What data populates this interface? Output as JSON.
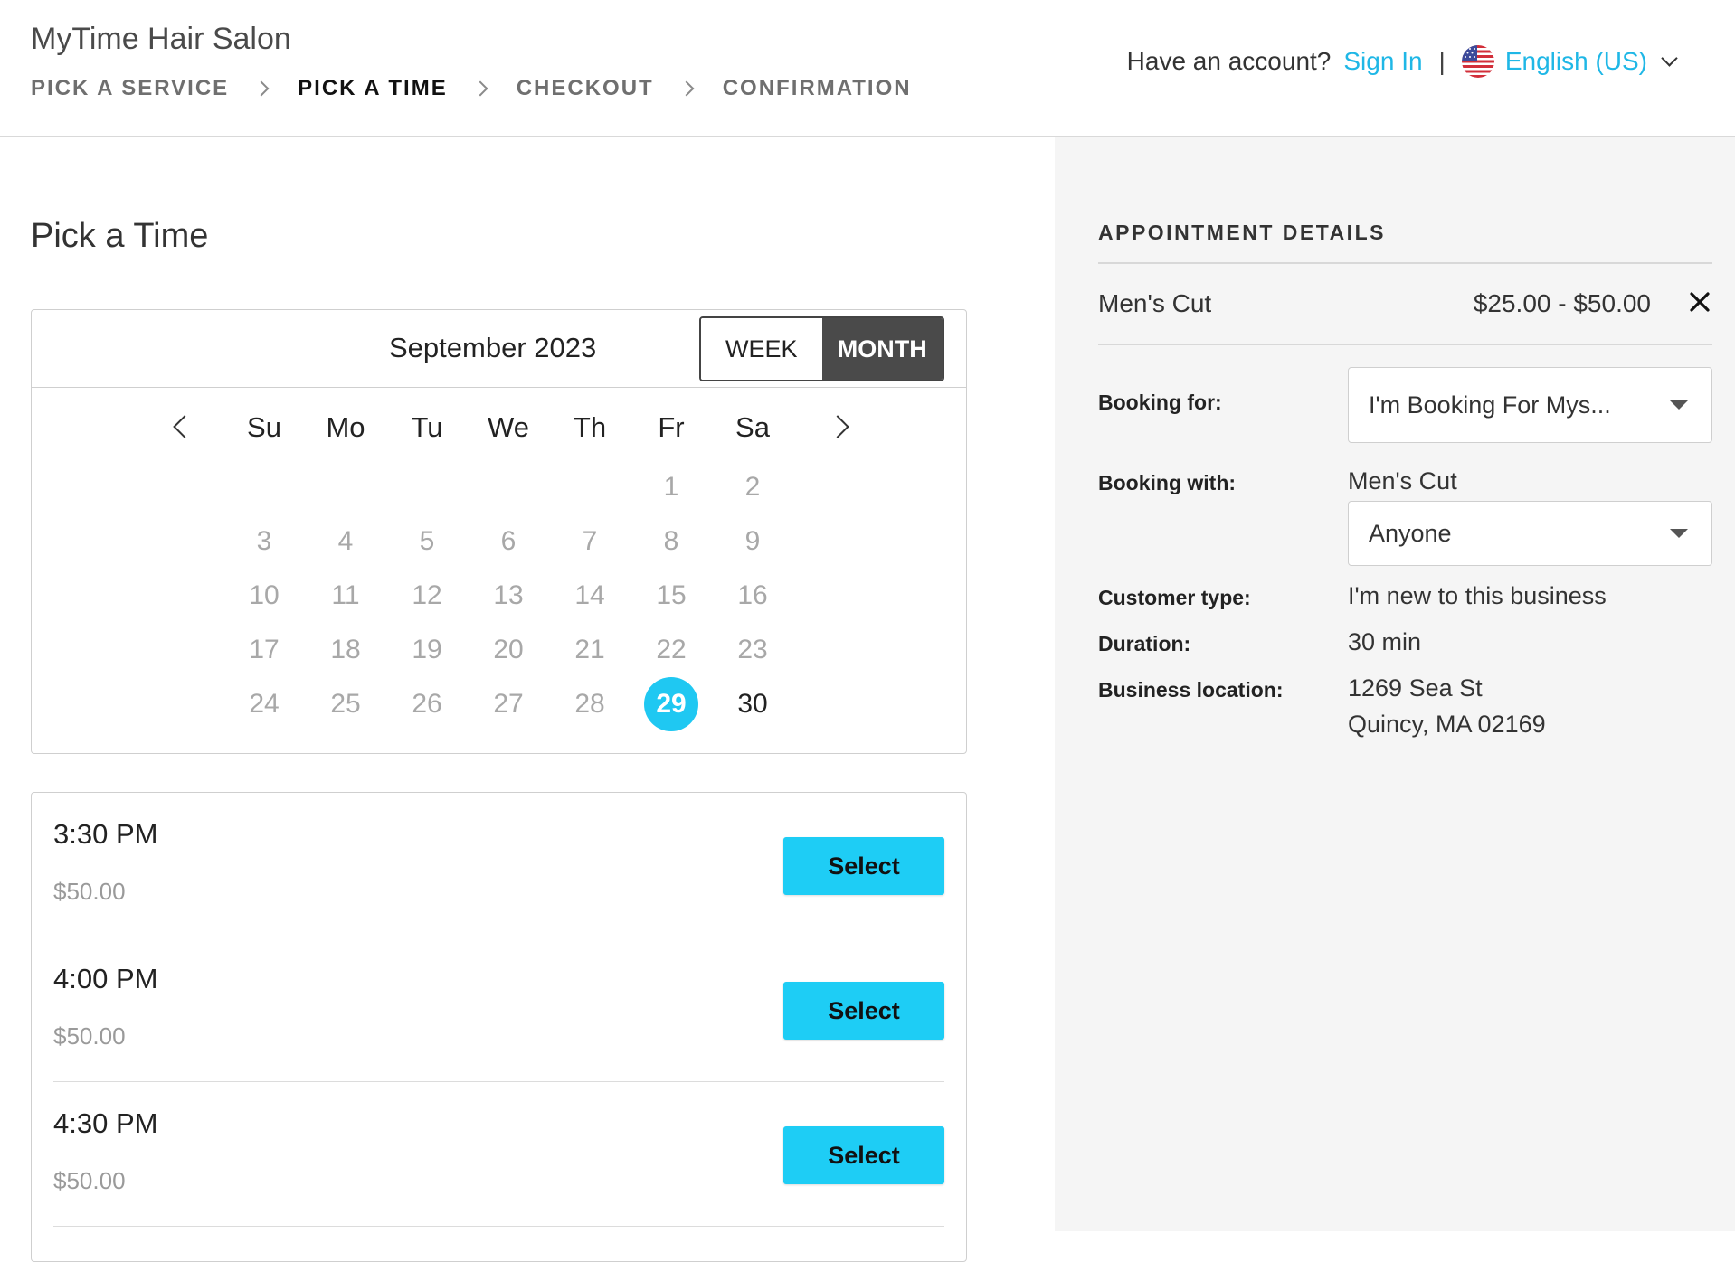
{
  "header": {
    "salon_name": "MyTime Hair Salon",
    "steps": [
      {
        "label": "PICK A SERVICE",
        "active": false
      },
      {
        "label": "PICK A TIME",
        "active": true
      },
      {
        "label": "CHECKOUT",
        "active": false
      },
      {
        "label": "CONFIRMATION",
        "active": false
      }
    ],
    "account_prompt": "Have an account?",
    "sign_in": "Sign In",
    "divider": "|",
    "language": "English (US)",
    "flag_icon": "us-flag-icon"
  },
  "main": {
    "title": "Pick a Time",
    "calendar": {
      "month_label": "September 2023",
      "view_week": "WEEK",
      "view_month": "MONTH",
      "active_view": "MONTH",
      "weekdays": [
        "Su",
        "Mo",
        "Tu",
        "We",
        "Th",
        "Fr",
        "Sa"
      ],
      "first_weekday_index": 5,
      "days_in_month": 30,
      "selected_day": 29,
      "available_days": [
        29,
        30
      ]
    },
    "slots": [
      {
        "time": "3:30 PM",
        "price": "$50.00",
        "button": "Select"
      },
      {
        "time": "4:00 PM",
        "price": "$50.00",
        "button": "Select"
      },
      {
        "time": "4:30 PM",
        "price": "$50.00",
        "button": "Select"
      }
    ]
  },
  "details": {
    "title": "APPOINTMENT DETAILS",
    "service_name": "Men's Cut",
    "service_price": "$25.00 - $50.00",
    "booking_for_label": "Booking for:",
    "booking_for_value": "I'm Booking For Mys...",
    "booking_with_label": "Booking with:",
    "booking_with_service": "Men's Cut",
    "booking_with_value": "Anyone",
    "customer_type_label": "Customer type:",
    "customer_type_value": "I'm new to this business",
    "duration_label": "Duration:",
    "duration_value": "30 min",
    "location_label": "Business location:",
    "location_line1": "1269 Sea St",
    "location_line2": "Quincy, MA 02169"
  },
  "colors": {
    "accent": "#1fc8f2",
    "link": "#1fb7e6",
    "panel_bg": "#f5f5f5",
    "toggle_active": "#4a4a4a"
  }
}
